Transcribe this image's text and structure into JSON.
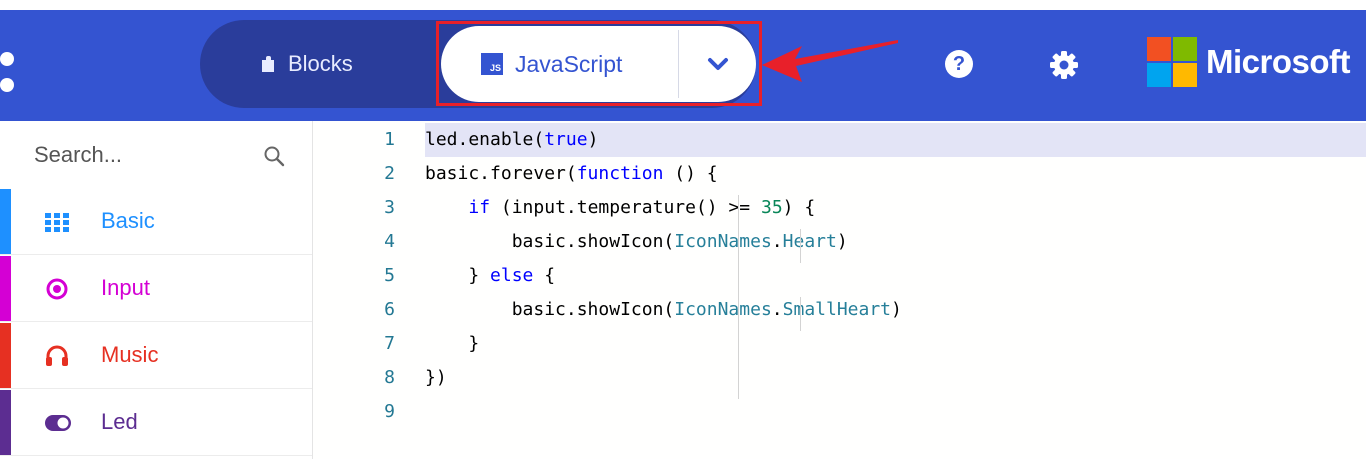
{
  "header": {
    "blocks_label": "Blocks",
    "js_badge": "JS",
    "js_label": "JavaScript",
    "logo_text": "Microsoft",
    "help_glyph": "?",
    "icons": [
      "menu-dots-icon",
      "puzzle-icon",
      "js-icon",
      "chevron-down-icon",
      "help-icon",
      "gear-icon",
      "microsoft-logo"
    ],
    "colors": {
      "bar": "#3454d1",
      "pill": "#2a3d9b",
      "highlight": "#e8202a"
    }
  },
  "sidebar": {
    "search_placeholder": "Search...",
    "categories": [
      {
        "label": "Basic",
        "icon": "grid-icon",
        "color": "#1e90ff"
      },
      {
        "label": "Input",
        "icon": "radio-target-icon",
        "color": "#d400d4"
      },
      {
        "label": "Music",
        "icon": "headphones-icon",
        "color": "#e63022"
      },
      {
        "label": "Led",
        "icon": "toggle-icon",
        "color": "#5c2d91"
      }
    ]
  },
  "editor": {
    "current_line": 1,
    "line_numbers": [
      "1",
      "2",
      "3",
      "4",
      "5",
      "6",
      "7",
      "8",
      "9"
    ],
    "lines": [
      [
        {
          "t": "led.enable("
        },
        {
          "t": "true",
          "c": "kw"
        },
        {
          "t": ")"
        }
      ],
      [
        {
          "t": "basic.forever("
        },
        {
          "t": "function",
          "c": "kw"
        },
        {
          "t": " () {"
        }
      ],
      [
        {
          "t": "    "
        },
        {
          "t": "if",
          "c": "kw"
        },
        {
          "t": " (input.temperature() >= "
        },
        {
          "t": "35",
          "c": "num"
        },
        {
          "t": ") {"
        }
      ],
      [
        {
          "t": "        basic.showIcon("
        },
        {
          "t": "IconNames",
          "c": "ty"
        },
        {
          "t": "."
        },
        {
          "t": "Heart",
          "c": "ty"
        },
        {
          "t": ")"
        }
      ],
      [
        {
          "t": "    } "
        },
        {
          "t": "else",
          "c": "kw"
        },
        {
          "t": " {"
        }
      ],
      [
        {
          "t": "        basic.showIcon("
        },
        {
          "t": "IconNames",
          "c": "ty"
        },
        {
          "t": "."
        },
        {
          "t": "SmallHeart",
          "c": "ty"
        },
        {
          "t": ")"
        }
      ],
      [
        {
          "t": "    }"
        }
      ],
      [
        {
          "t": "})"
        }
      ],
      []
    ]
  }
}
